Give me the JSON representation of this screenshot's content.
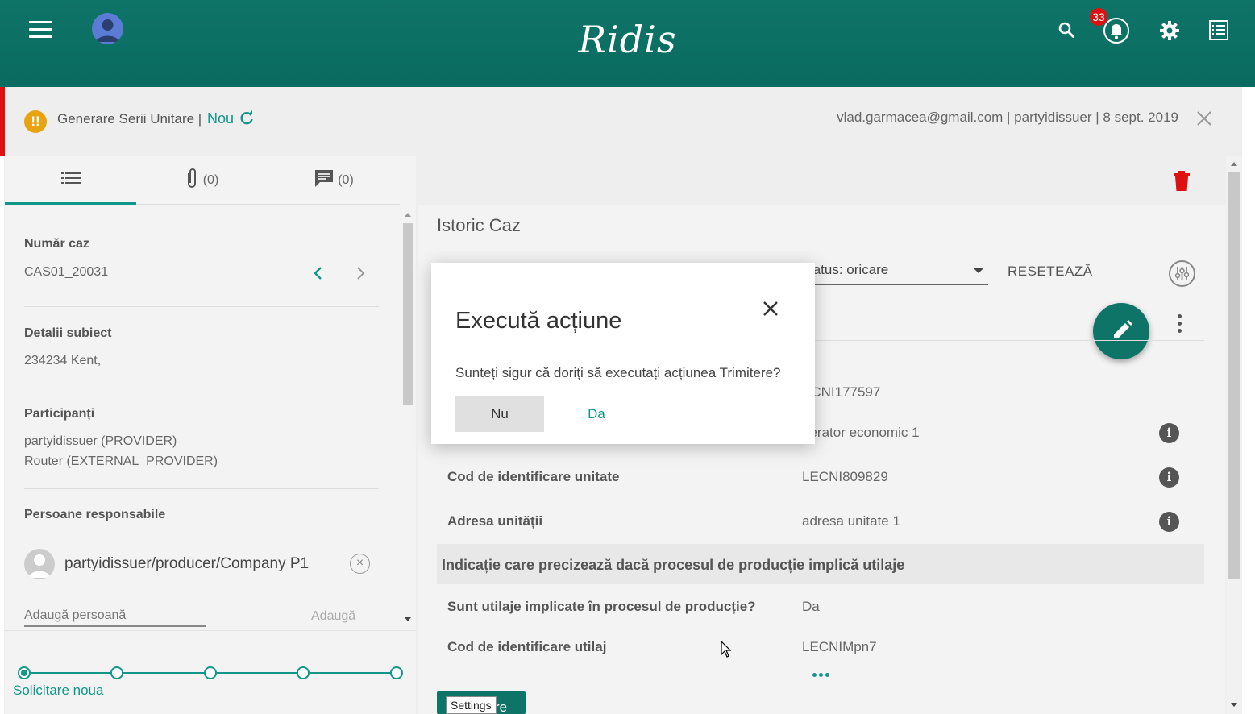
{
  "app": {
    "brand": "Ridis",
    "notification_count": "33"
  },
  "case": {
    "title": "Generare Serii Unitare |",
    "state": "Nou",
    "meta": "vlad.garmacea@gmail.com | partyidissuer | 8 sept. 2019"
  },
  "tabs": {
    "attachments": "(0)",
    "comments": "(0)"
  },
  "details": {
    "case_number_label": "Număr caz",
    "case_number": "CAS01_20031",
    "subject_label": "Detalii subiect",
    "subject": "234234 Kent,",
    "participants_label": "Participanți",
    "participants": [
      "partyidissuer (PROVIDER)",
      "Router (EXTERNAL_PROVIDER)"
    ],
    "responsible_label": "Persoane responsabile",
    "responsible_person": "partyidissuer/producer/Company P1",
    "add_person_placeholder": "Adaugă persoană",
    "add_button": "Adaugă",
    "step_label": "Solicitare noua"
  },
  "history": {
    "title": "Istoric Caz",
    "status_filter": "tatus: oricare",
    "reset": "RESETEAZĂ",
    "rows": [
      {
        "label": "",
        "value": "ECNI177597"
      },
      {
        "label": "",
        "value": "perator economic 1"
      },
      {
        "label": "Cod de identificare unitate",
        "value": "LECNI809829"
      },
      {
        "label": "Adresa unității",
        "value": "adresa unitate 1"
      }
    ],
    "group_header": "Indicație care precizează dacă procesul de producție implică utilaje",
    "rows2": [
      {
        "label": "Sunt utilaje implicate în procesul de producție?",
        "value": "Da"
      },
      {
        "label": "Cod de identificare utilaj",
        "value": "LECNIMpn7"
      }
    ],
    "bottom_button": "re",
    "tooltip": "Settings"
  },
  "dialog": {
    "title": "Execută acțiune",
    "message": "Sunteți sigur că doriți să executați acțiunea Trimitere?",
    "no": "Nu",
    "yes": "Da"
  }
}
